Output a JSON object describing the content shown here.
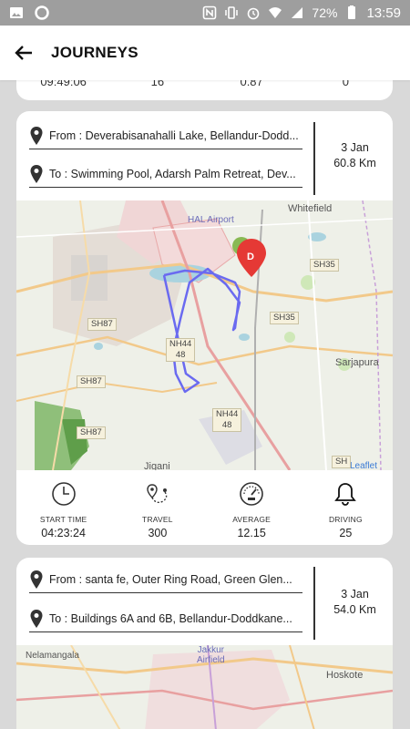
{
  "status_bar": {
    "battery": "72%",
    "time": "13:59"
  },
  "app_bar": {
    "title": "JOURNEYS"
  },
  "partial_card": {
    "start_time": "09:49:06",
    "travel": "16",
    "average": "0.87",
    "driving": "0"
  },
  "journeys": [
    {
      "from": "From : Deverabisanahalli Lake, Bellandur-Dodd...",
      "to": "To : Swimming Pool, Adarsh Palm Retreat, Dev...",
      "date": "3 Jan",
      "distance": "60.8 Km",
      "map_labels": {
        "airport": "HAL Airport",
        "whitefield": "Whitefield",
        "sarjapura": "Sarjapura",
        "jigani": "Jigani",
        "leaflet": "Leaflet",
        "sh35_a": "SH35",
        "sh35_b": "SH35",
        "sh87_a": "SH87",
        "sh87_b": "SH87",
        "sh87_c": "SH87",
        "nh44_a": "NH44\n48",
        "nh44_b": "NH44\n48",
        "sh": "SH",
        "marker": "D"
      },
      "stats": {
        "start_time_label": "START TIME",
        "start_time": "04:23:24",
        "travel_label": "TRAVEL",
        "travel": "300",
        "average_label": "AVERAGE",
        "average": "12.15",
        "driving_label": "DRIVING",
        "driving": "25"
      }
    },
    {
      "from": "From : santa fe, Outer Ring Road, Green Glen...",
      "to": "To : Buildings 6A and 6B, Bellandur-Doddkane...",
      "date": "3 Jan",
      "distance": "54.0 Km",
      "map_labels": {
        "nelamangala": "Nelamangala",
        "jakkur": "Jakkur\nAirfield",
        "hoskote": "Hoskote"
      }
    }
  ],
  "colors": {
    "route": "#6a6af0",
    "marker_red": "#e53935",
    "marker_green": "#7cb342",
    "status_bar": "#9e9e9e"
  }
}
